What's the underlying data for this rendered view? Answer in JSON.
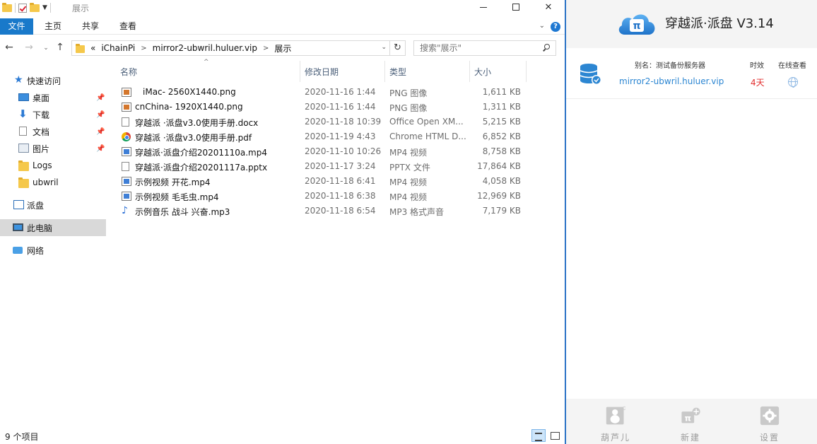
{
  "explorer": {
    "title": "展示",
    "ribbon_tabs": [
      "文件",
      "主页",
      "共享",
      "查看"
    ],
    "help_glyph": "?",
    "breadcrumb": {
      "lead": "«",
      "parts": [
        "iChainPi",
        "mirror2-ubwril.huluer.vip",
        "展示"
      ]
    },
    "search_placeholder": "搜索\"展示\"",
    "sidebar": [
      {
        "label": "快速访问",
        "icon": "star-icon",
        "pinned": false
      },
      {
        "label": "桌面",
        "icon": "desktop-icon",
        "pinned": true
      },
      {
        "label": "下载",
        "icon": "download-icon",
        "pinned": true
      },
      {
        "label": "文档",
        "icon": "document-icon",
        "pinned": true
      },
      {
        "label": "图片",
        "icon": "pictures-icon",
        "pinned": true
      },
      {
        "label": "Logs",
        "icon": "folder-icon",
        "pinned": false
      },
      {
        "label": "ubwril",
        "icon": "folder-icon",
        "pinned": false
      },
      {
        "label": "派盘",
        "icon": "drive-icon",
        "pinned": false
      },
      {
        "label": "此电脑",
        "icon": "pc-icon",
        "pinned": false,
        "selected": true
      },
      {
        "label": "网络",
        "icon": "network-icon",
        "pinned": false
      }
    ],
    "columns": [
      "名称",
      "修改日期",
      "类型",
      "大小"
    ],
    "files": [
      {
        "name": "iMac- 2560X1440.png",
        "date": "2020-11-16 1:44",
        "type": "PNG 图像",
        "size": "1,611 KB",
        "icon": "png"
      },
      {
        "name": "cnChina- 1920X1440.png",
        "date": "2020-11-16 1:44",
        "type": "PNG 图像",
        "size": "1,311 KB",
        "icon": "png"
      },
      {
        "name": "穿越派 ·派盘v3.0使用手册.docx",
        "date": "2020-11-18 10:39",
        "type": "Office Open XM...",
        "size": "5,215 KB",
        "icon": "doc"
      },
      {
        "name": "穿越派 ·派盘v3.0使用手册.pdf",
        "date": "2020-11-19 4:43",
        "type": "Chrome HTML D...",
        "size": "6,852 KB",
        "icon": "pdf"
      },
      {
        "name": "穿越派·派盘介绍20201110a.mp4",
        "date": "2020-11-10 10:26",
        "type": "MP4 视频",
        "size": "8,758 KB",
        "icon": "mp4"
      },
      {
        "name": "穿越派·派盘介绍20201117a.pptx",
        "date": "2020-11-17 3:24",
        "type": "PPTX 文件",
        "size": "17,864 KB",
        "icon": "doc"
      },
      {
        "name": "示例视频 开花.mp4",
        "date": "2020-11-18 6:41",
        "type": "MP4 视频",
        "size": "4,058 KB",
        "icon": "mp4"
      },
      {
        "name": "示例视频 毛毛虫.mp4",
        "date": "2020-11-18 6:38",
        "type": "MP4 视频",
        "size": "12,969 KB",
        "icon": "mp4"
      },
      {
        "name": "示例音乐 战斗 兴奋.mp3",
        "date": "2020-11-18 6:54",
        "type": "MP3 格式声音",
        "size": "7,179 KB",
        "icon": "mp3"
      }
    ],
    "status": "9 个项目"
  },
  "app": {
    "title": "穿越派·派盘 V3.14",
    "logo_text": "π",
    "server": {
      "alias": "别名：测试备份服务器",
      "name": "mirror2-ubwril.huluer.vip",
      "timeliness_label": "时效",
      "timeliness_value": "4天",
      "online_label": "在线查看"
    },
    "footer": {
      "gourd": "葫芦儿",
      "new": "新建",
      "settings": "设置"
    },
    "colors": {
      "accent": "#2c86d2",
      "alert": "#e23030",
      "muted": "#9b9b9b"
    }
  }
}
